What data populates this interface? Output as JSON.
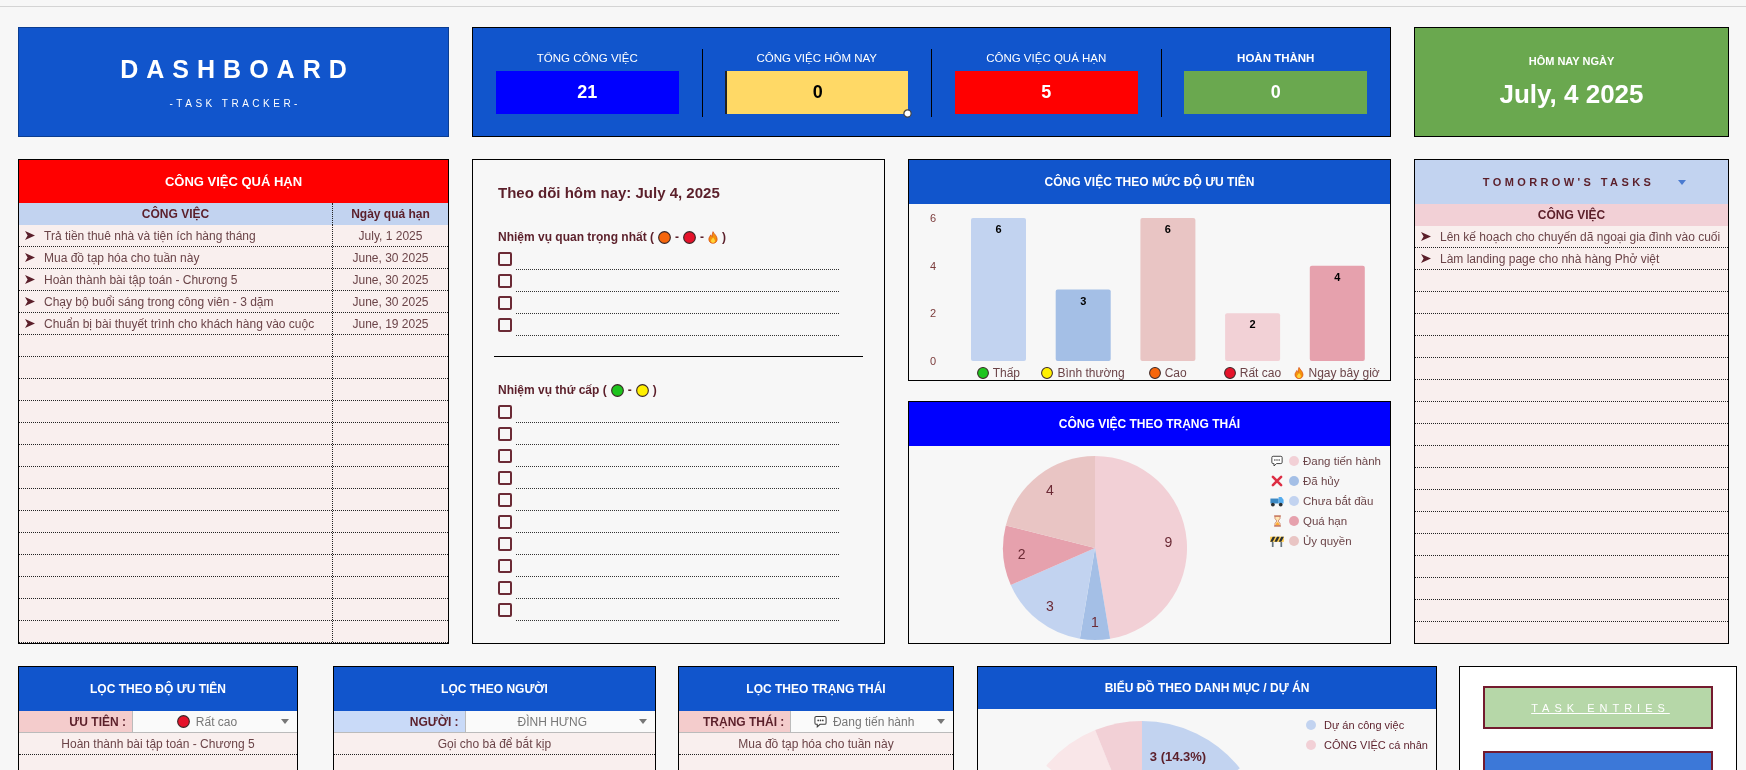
{
  "dashboard_title": {
    "title": "DASHBOARD",
    "subtitle": "-TASK TRACKER-"
  },
  "kpis": [
    {
      "label": "TỔNG CÔNG VIỆC",
      "value": "21",
      "color": "#0000ff",
      "bold": false,
      "selected": false
    },
    {
      "label": "CÔNG VIỆC HÔM NAY",
      "value": "0",
      "color": "#ffd966",
      "bold": false,
      "selected": true
    },
    {
      "label": "CÔNG VIỆC QUÁ HẠN",
      "value": "5",
      "color": "#ff0000",
      "bold": false,
      "selected": false
    },
    {
      "label": "HOÀN THÀNH",
      "value": "0",
      "color": "#6aa84f",
      "bold": true,
      "selected": false
    }
  ],
  "today": {
    "label": "HÔM NAY NGÀY",
    "date": "July, 4 2025"
  },
  "overdue": {
    "title": "CÔNG VIỆC QUÁ HẠN",
    "columns": [
      "CÔNG VIỆC",
      "Ngày quá hạn"
    ],
    "rows": [
      {
        "task": "Trả tiền thuê nhà và tiện ích hàng tháng",
        "date": "July, 1 2025"
      },
      {
        "task": "Mua đồ tạp hóa cho tuần này",
        "date": "June, 30 2025"
      },
      {
        "task": "Hoàn thành bài tập toán - Chương 5",
        "date": "June, 30 2025"
      },
      {
        "task": "Chạy bộ buổi sáng trong công viên - 3 dặm",
        "date": "June, 30 2025"
      },
      {
        "task": "Chuẩn bị bài thuyết trình cho khách hàng vào cuộc",
        "date": "June, 19 2025"
      }
    ]
  },
  "tracker": {
    "title": "Theo dõi hôm nay: July 4, 2025",
    "sections": [
      {
        "label_parts": [
          "Nhiệm vụ quan trọng nhất (",
          "-",
          "-",
          ")"
        ],
        "markers": [
          {
            "kind": "dot",
            "color": "#f6660c"
          },
          {
            "kind": "dot",
            "color": "#e5132b"
          },
          {
            "kind": "fire"
          }
        ],
        "tasks": [
          {
            "checked": false
          },
          {
            "checked": false
          },
          {
            "checked": false
          },
          {
            "checked": false
          }
        ]
      },
      {
        "label_parts": [
          "Nhiệm vụ thứ cấp (",
          "-",
          ")"
        ],
        "markers": [
          {
            "kind": "dot",
            "color": "#1ec41e"
          },
          {
            "kind": "dot",
            "color": "#fff000"
          }
        ],
        "tasks": [
          {
            "checked": false
          },
          {
            "checked": false
          },
          {
            "checked": false
          },
          {
            "checked": false
          },
          {
            "checked": false
          },
          {
            "checked": false
          },
          {
            "checked": false
          },
          {
            "checked": false
          },
          {
            "checked": false
          },
          {
            "checked": false
          }
        ]
      }
    ]
  },
  "priority_chart": {
    "title": "CÔNG VIỆC THEO MỨC ĐỘ ƯU TIÊN",
    "bars": [
      {
        "color": "#c2d3f0",
        "marker": {
          "kind": "dot",
          "color": "#1ec41e"
        }
      },
      {
        "color": "#a4bfe6",
        "marker": {
          "kind": "dot",
          "color": "#fff000"
        }
      },
      {
        "color": "#e9c5c4",
        "marker": {
          "kind": "dot",
          "color": "#f6660c"
        }
      },
      {
        "color": "#f2d1d6",
        "marker": {
          "kind": "dot",
          "color": "#e5132b"
        }
      },
      {
        "color": "#e6a1ad",
        "marker": {
          "kind": "fire"
        }
      }
    ],
    "chart_data": {
      "type": "bar",
      "categories": [
        "Thấp",
        "Bình thường",
        "Cao",
        "Rất cao",
        "Ngay bây giờ"
      ],
      "values": [
        6,
        3,
        6,
        2,
        4
      ],
      "ylim": [
        0,
        6
      ],
      "yticks": [
        0,
        2,
        4,
        6
      ],
      "data_labels": true
    }
  },
  "status_chart": {
    "title": "CÔNG VIỆC THEO TRẠNG THÁI",
    "slices": [
      {
        "color": "#f2d0d6",
        "icon": {
          "kind": "speech"
        }
      },
      {
        "color": "#a4bfe6",
        "icon": {
          "kind": "cross"
        }
      },
      {
        "color": "#c2d3f0",
        "icon": {
          "kind": "truck"
        }
      },
      {
        "color": "#e6a1ad",
        "icon": {
          "kind": "hourglass"
        }
      },
      {
        "color": "#e9c5c4",
        "icon": {
          "kind": "barrier"
        }
      }
    ],
    "chart_data": {
      "type": "pie",
      "categories": [
        "Đang tiến hành",
        "Đã hủy",
        "Chưa bắt đầu",
        "Quá hạn",
        "Ủy quyền"
      ],
      "values": [
        9,
        1,
        3,
        2,
        4
      ],
      "data_labels": true,
      "legend": "right"
    }
  },
  "tomorrow": {
    "title": "TOMORROW'S TASKS",
    "column": "CÔNG VIỆC",
    "rows": [
      "Lên kế hoạch cho chuyến dã ngoại gia đình vào cuối",
      "Làm landing page cho nhà hàng Phở việt"
    ]
  },
  "filters": [
    {
      "title": "LỌC THEO ĐỘ ƯU TIÊN",
      "field_label": "ƯU TIÊN :",
      "color": "#f4cccc",
      "value": "Rất cao",
      "value_marker": {
        "kind": "dot",
        "color": "#e5132b"
      },
      "results": [
        "Hoàn thành bài tập toán - Chương 5"
      ]
    },
    {
      "title": "LỌC THEO NGƯỜI",
      "field_label": "NGƯỜI :",
      "color": "#c9daf8",
      "value": "ĐÌNH HƯNG",
      "results": [
        "Gọi cho bà để bắt kịp"
      ]
    },
    {
      "title": "LỌC THEO TRẠNG THÁI",
      "field_label": "TRẠNG THÁI :",
      "color": "#f4cccc",
      "value": "Đang tiến hành",
      "value_marker": {
        "kind": "speech"
      },
      "results": [
        "Mua đồ tạp hóa cho tuần này"
      ]
    }
  ],
  "category_chart": {
    "title": "BIỂU ĐỒ THEO DANH MỤC / DỰ ÁN",
    "slice_label": "3 (14.3%)",
    "legend": [
      {
        "label": "Dự án công việc",
        "color": "#c2d3f0"
      },
      {
        "label": "CÔNG VIỆC cá nhân",
        "color": "#f2d0d6"
      }
    ]
  },
  "entries": {
    "buttons": [
      {
        "label": "TASK ENTRIES",
        "color": "#b6d7a8"
      },
      {
        "color": "#3c78d8"
      }
    ]
  }
}
